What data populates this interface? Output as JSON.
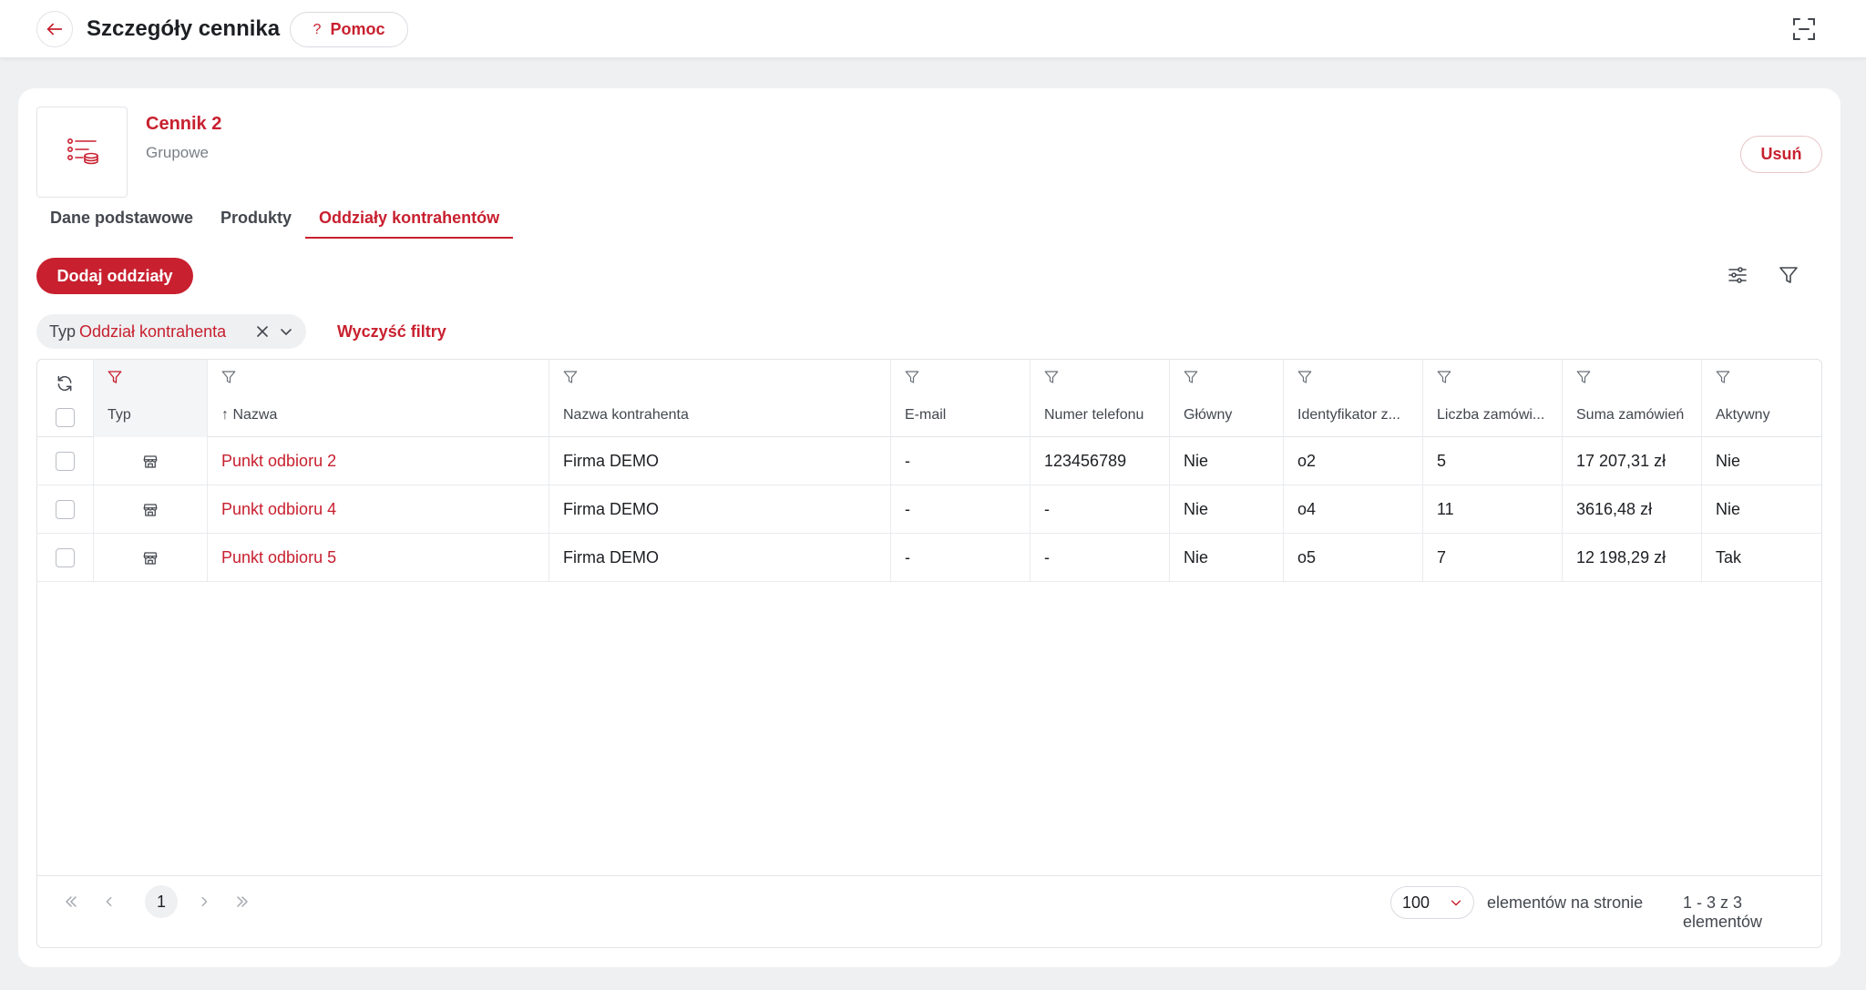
{
  "header": {
    "title": "Szczegóły cennika",
    "help_label": "Pomoc",
    "help_glyph": "?"
  },
  "pricelist": {
    "name": "Cennik 2",
    "type": "Grupowe",
    "delete_label": "Usuń"
  },
  "tabs": [
    {
      "label": "Dane podstawowe",
      "active": false
    },
    {
      "label": "Produkty",
      "active": false
    },
    {
      "label": "Oddziały kontrahentów",
      "active": true
    }
  ],
  "toolbar": {
    "add_label": "Dodaj oddziały"
  },
  "filters": {
    "chip_label": "Typ",
    "chip_value": "Oddział kontrahenta",
    "clear_label": "Wyczyść filtry"
  },
  "table": {
    "columns": [
      {
        "key": "typ",
        "title": "Typ"
      },
      {
        "key": "nazwa",
        "title": "↑ Nazwa"
      },
      {
        "key": "kontrahent",
        "title": "Nazwa kontrahenta"
      },
      {
        "key": "email",
        "title": "E-mail"
      },
      {
        "key": "telefon",
        "title": "Numer telefonu"
      },
      {
        "key": "glowny",
        "title": "Główny"
      },
      {
        "key": "identyfikator",
        "title": "Identyfikator z..."
      },
      {
        "key": "liczba",
        "title": "Liczba zamówi..."
      },
      {
        "key": "suma",
        "title": "Suma zamówień"
      },
      {
        "key": "aktywny",
        "title": "Aktywny"
      }
    ],
    "rows": [
      {
        "nazwa": "Punkt odbioru 2",
        "kontrahent": "Firma DEMO",
        "email": "-",
        "telefon": "123456789",
        "glowny": "Nie",
        "identyfikator": "o2",
        "liczba": "5",
        "suma": "17 207,31 zł",
        "aktywny": "Nie"
      },
      {
        "nazwa": "Punkt odbioru 4",
        "kontrahent": "Firma DEMO",
        "email": "-",
        "telefon": "-",
        "glowny": "Nie",
        "identyfikator": "o4",
        "liczba": "11",
        "suma": "3616,48 zł",
        "aktywny": "Nie"
      },
      {
        "nazwa": "Punkt odbioru 5",
        "kontrahent": "Firma DEMO",
        "email": "-",
        "telefon": "-",
        "glowny": "Nie",
        "identyfikator": "o5",
        "liczba": "7",
        "suma": "12 198,29 zł",
        "aktywny": "Tak"
      }
    ]
  },
  "pagination": {
    "current_page": "1",
    "page_size": "100",
    "per_page_label": "elementów na stronie",
    "range_label": "1 - 3 z 3 elementów"
  },
  "colors": {
    "accent": "#c8202f",
    "background": "#eef0f2",
    "text": "#1d1f23"
  },
  "icons": [
    "arrow-left-icon",
    "help-icon",
    "fullscreen-icon",
    "list-coins-icon",
    "settings-sliders-icon",
    "filter-icon",
    "close-icon",
    "chevron-down-icon",
    "refresh-icon",
    "store-icon",
    "sort-up-icon"
  ]
}
